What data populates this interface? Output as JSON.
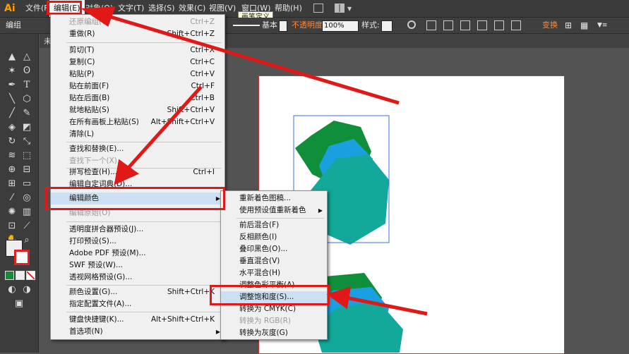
{
  "app": {
    "logo": "Ai"
  },
  "menubar": {
    "items": [
      "文件(F)",
      "编辑(E)",
      "对象(O)",
      "文字(T)",
      "选择(S)",
      "效果(C)",
      "视图(V)",
      "窗口(W)",
      "帮助(H)"
    ],
    "tooltip": "画笔定义"
  },
  "control_bar": {
    "mode_label": "编组",
    "stroke_label": "基本",
    "opacity_label": "不透明度",
    "opacity_value": "100%",
    "style_label": "样式:",
    "transform_label": "变换"
  },
  "document_tab": {
    "label": "未"
  },
  "edit_menu": {
    "items": [
      {
        "label": "还原编组(U)",
        "shortcut": "Ctrl+Z"
      },
      {
        "label": "重做(R)",
        "shortcut": "Shift+Ctrl+Z"
      },
      {
        "label": "剪切(T)",
        "shortcut": "Ctrl+X"
      },
      {
        "label": "复制(C)",
        "shortcut": "Ctrl+C"
      },
      {
        "label": "粘贴(P)",
        "shortcut": "Ctrl+V"
      },
      {
        "label": "贴在前面(F)",
        "shortcut": "Ctrl+F"
      },
      {
        "label": "贴在后面(B)",
        "shortcut": "Ctrl+B"
      },
      {
        "label": "就地粘贴(S)",
        "shortcut": "Shift+Ctrl+V"
      },
      {
        "label": "在所有画板上粘贴(S)",
        "shortcut": "Alt+Shift+Ctrl+V"
      },
      {
        "label": "清除(L)",
        "shortcut": ""
      },
      {
        "label": "查找和替换(E)...",
        "shortcut": ""
      },
      {
        "label": "查找下一个(X)",
        "shortcut": ""
      },
      {
        "label": "拼写检查(H)...",
        "shortcut": "Ctrl+I"
      },
      {
        "label": "编辑自定词典(D)...",
        "shortcut": ""
      },
      {
        "label": "编辑颜色",
        "shortcut": ""
      },
      {
        "label": "编辑原始(O)",
        "shortcut": ""
      },
      {
        "label": "透明度拼合器预设(J)...",
        "shortcut": ""
      },
      {
        "label": "打印预设(S)...",
        "shortcut": ""
      },
      {
        "label": "Adobe PDF 预设(M)...",
        "shortcut": ""
      },
      {
        "label": "SWF 预设(W)...",
        "shortcut": ""
      },
      {
        "label": "透视网格预设(G)...",
        "shortcut": ""
      },
      {
        "label": "颜色设置(G)...",
        "shortcut": "Shift+Ctrl+K"
      },
      {
        "label": "指定配置文件(A)...",
        "shortcut": ""
      },
      {
        "label": "键盘快捷键(K)...",
        "shortcut": "Alt+Shift+Ctrl+K"
      },
      {
        "label": "首选项(N)",
        "shortcut": ""
      }
    ]
  },
  "edit_colors_submenu": {
    "items": [
      {
        "label": "重新着色图稿..."
      },
      {
        "label": "使用预设值重新着色"
      },
      {
        "label": "前后混合(F)"
      },
      {
        "label": "反相颜色(I)"
      },
      {
        "label": "叠印黑色(O)..."
      },
      {
        "label": "垂直混合(V)"
      },
      {
        "label": "水平混合(H)"
      },
      {
        "label": "调整色彩平衡(A)..."
      },
      {
        "label": "调整饱和度(S)..."
      },
      {
        "label": "转换为 CMYK(C)"
      },
      {
        "label": "转换为 RGB(R)"
      },
      {
        "label": "转换为灰度(G)"
      }
    ]
  },
  "colors": {
    "menu_bg": "#f0f0f0",
    "highlight": "#cce0f4",
    "annotation_red": "#e01818",
    "shape_green": "#0f8f3a",
    "shape_blue": "#1a9fe0",
    "shape_teal": "#12a89a"
  },
  "icons": [
    "selection-tool-icon",
    "direct-selection-icon",
    "magic-wand-icon",
    "lasso-icon",
    "pen-tool-icon",
    "type-tool-icon",
    "line-tool-icon",
    "rectangle-tool-icon",
    "paintbrush-icon",
    "pencil-icon",
    "rotate-icon",
    "scale-icon",
    "hand-icon",
    "zoom-icon",
    "fill-stroke-icon"
  ]
}
